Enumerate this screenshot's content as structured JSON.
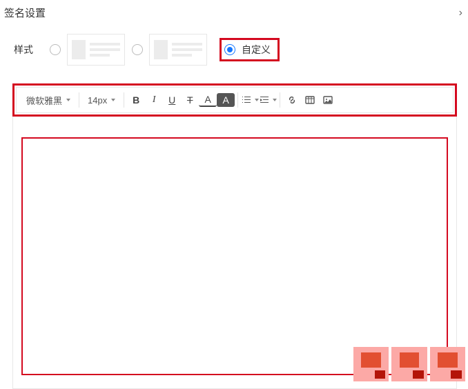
{
  "dialog": {
    "title": "签名设置",
    "close_glyph": "›"
  },
  "style_row": {
    "label": "样式",
    "options": {
      "template1": {
        "selected": false
      },
      "template2": {
        "selected": false
      },
      "custom": {
        "selected": true,
        "label": "自定义"
      }
    }
  },
  "toolbar": {
    "font_family": "微软雅黑",
    "font_size": "14px",
    "bold_glyph": "B",
    "italic_glyph": "I",
    "underline_glyph": "U",
    "strike_glyph": "T",
    "font_color_glyph": "A",
    "bg_color_glyph": "A"
  }
}
